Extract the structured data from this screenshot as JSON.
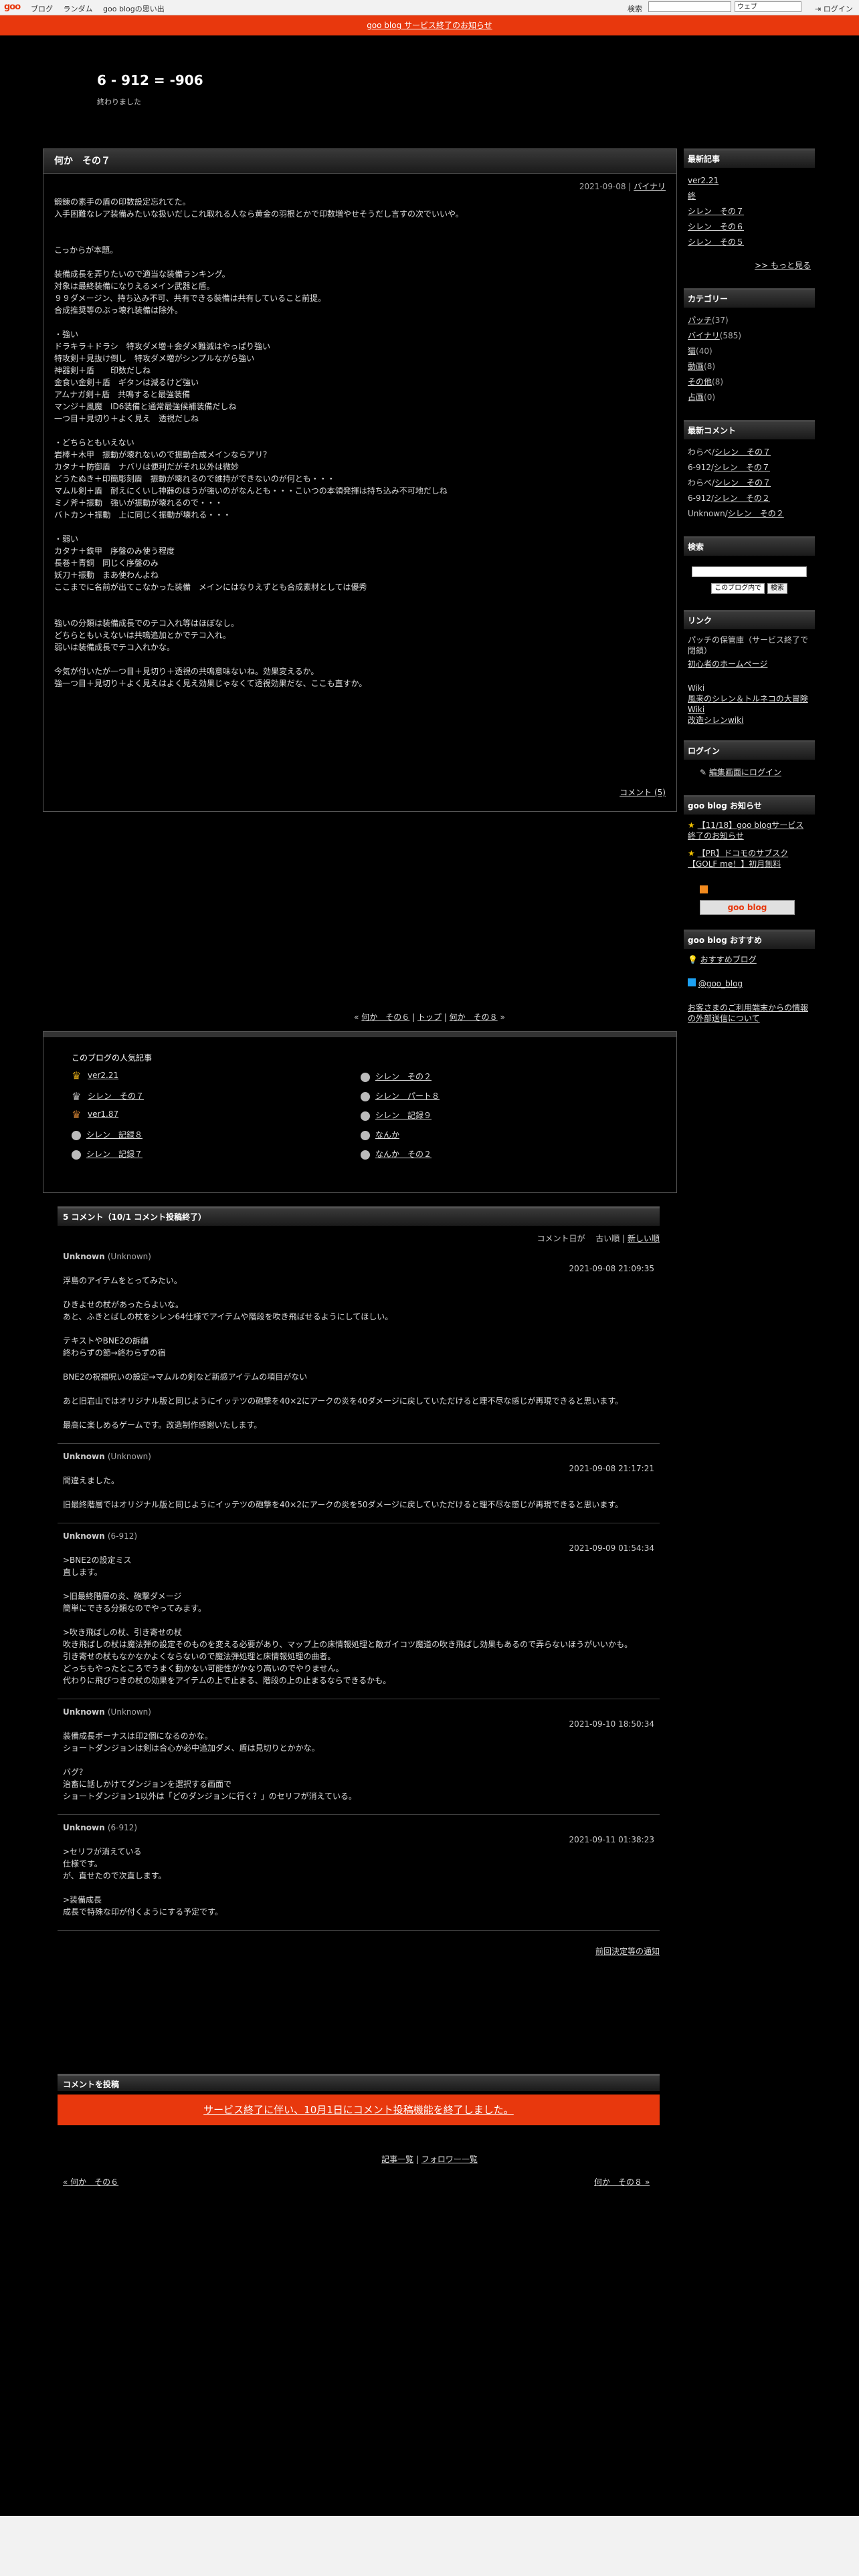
{
  "topbar": {
    "logo": "goo",
    "nav": [
      "ブログ",
      "ランダム",
      "goo blogの思い出"
    ],
    "search_label": "検索",
    "search_select": "ウェブ",
    "login": "ログイン"
  },
  "notice": "goo blog サービス終了のお知らせ",
  "blog": {
    "title": "6 - 912 = -906",
    "subtitle": "終わりました"
  },
  "article": {
    "title": "何か　その７",
    "date": "2021-09-08",
    "category": "バイナリ",
    "lines": [
      "鍛錬の素手の盾の印数設定忘れてた。",
      "入手困難なレア装備みたいな扱いだしこれ取れる人なら黄金の羽根とかで印数増やせそうだし言すの次でいいや。",
      "",
      "",
      "こっからが本題。",
      "",
      "装備成長を弄りたいので適当な装備ランキング。",
      "対象は最終装備になりえるメイン武器と盾。",
      "９９ダメージン、持ち込み不可、共有できる装備は共有していること前提。",
      "合成推奨等のぶっ壊れ装備は除外。",
      "",
      "・強い",
      "ドラキラ＋ドラシ　特攻ダメ増＋会ダメ難減はやっぱり強い",
      "特攻剣＋見抜け倒し　特攻ダメ増がシンプルながら強い",
      "神器剣＋盾　　印数だしね",
      "金食い金剣＋盾　ギタンは減るけど強い",
      "アムナガ剣＋盾　共鳴すると最強装備",
      "マンジ＋風魔　ID6装備と通常最強候補装備だしね",
      "一つ目＋見切り＋よく見え　透視だしね",
      "",
      "・どちらともいえない",
      "岩棒＋木甲　振動が壊れないので振動合成メインならアリ？",
      "カタナ＋防御盾　ナバリは便利だがそれ以外は微妙",
      "どうたぬき＋印簡彫刻盾　振動が壊れるので維持ができないのが何とも・・・",
      "マムル剣＋盾　耐えにくいし神器のほうが強いのがなんとも・・・こいつの本領発揮は持ち込み不可地だしね",
      "ミノ斧＋振動　強いが振動が壊れるので・・・",
      "バトカン＋振動　上に同じく振動が壊れる・・・",
      "",
      "・弱い",
      "カタナ＋鉄甲　序盤のみ使う程度",
      "長巻＋青銅　同じく序盤のみ",
      "妖刀＋振動　まあ使わんよね",
      "ここまでに名前が出てこなかった装備　メインにはなりえずとも合成素材としては優秀",
      "",
      "",
      "強いの分類は装備成長でのテコ入れ等はほぼなし。",
      "どちらともいえないは共鳴追加とかでテコ入れ。",
      "弱いは装備成長でテコ入れかな。",
      "",
      "今気が付いたが一つ目＋見切り＋透視の共鳴意味ないね。効果変えるか。",
      "強一つ目＋見切り＋よく見えはよく見え効果じゃなくて透視効果だな、ここも直すか。"
    ],
    "comment_link": "コメント (5)"
  },
  "pager": {
    "prev": "何か　その６",
    "top": "トップ",
    "next": "何か　その８"
  },
  "popular": {
    "title": "このブログの人気記事",
    "left": [
      "ver2.21",
      "シレン　その７",
      "ver1.87",
      "シレン　記録８",
      "シレン　記録７"
    ],
    "right": [
      "シレン　その２",
      "シレン　パート８",
      "シレン　記録９",
      "なんか",
      "なんか　その２"
    ]
  },
  "sidebar": {
    "recent": {
      "title": "最新記事",
      "items": [
        "ver2.21",
        "終",
        "シレン　その７",
        "シレン　その６",
        "シレン　その５"
      ],
      "more": ">> もっと見る"
    },
    "category": {
      "title": "カテゴリー",
      "items": [
        {
          "name": "パッチ",
          "count": "(37)"
        },
        {
          "name": "バイナリ",
          "count": "(585)"
        },
        {
          "name": "猫",
          "count": "(40)"
        },
        {
          "name": "動画",
          "count": "(8)"
        },
        {
          "name": "その他",
          "count": "(8)"
        },
        {
          "name": "占画",
          "count": "(0)"
        }
      ]
    },
    "latest_comments": {
      "title": "最新コメント",
      "items": [
        {
          "who": "わらべ/",
          "post": "シレン　その７"
        },
        {
          "who": "6-912/",
          "post": "シレン　その７"
        },
        {
          "who": "わらべ/",
          "post": "シレン　その７"
        },
        {
          "who": "6-912/",
          "post": "シレン　その２"
        },
        {
          "who": "Unknown/",
          "post": "シレン　その２"
        }
      ]
    },
    "search": {
      "title": "検索",
      "select": "このブログ内で",
      "button": "検索"
    },
    "links": {
      "title": "リンク",
      "items": [
        "パッチの保管庫（サービス終了で閉鎖）",
        "初心者のホームページ",
        "Wiki",
        "風来のシレン＆トルネコの大冒険 Wiki",
        "改造シレンwiki"
      ]
    },
    "login": {
      "title": "ログイン",
      "item": "編集画面にログイン"
    },
    "info": {
      "title": "goo blog お知らせ",
      "items": [
        "【11/18】goo blogサービス終了のお知らせ",
        "【PR】ドコモのサブスク【GOLF me！】初月無料"
      ],
      "badge": "goo blog"
    },
    "recommend": {
      "title": "goo blog おすすめ",
      "item": "おすすめブログ",
      "twitter": "@goo_blog",
      "external": "お客さまのご利用端末からの情報の外部送信について"
    }
  },
  "comments": {
    "header": "5 コメント（10/1 コメント投稿終了）",
    "sort_label": "コメント日が",
    "sort_old": "古い順",
    "sort_new": "新しい順",
    "items": [
      {
        "author": "Unknown",
        "paren": "(Unknown)",
        "date": "2021-09-08 21:09:35",
        "lines": [
          "浮島のアイテムをとってみたい。",
          "",
          "ひきよせの杖があったらよいな。",
          "あと、ふきとばしの杖をシレン64仕様でアイテムや階段を吹き飛ばせるようにしてほしい。",
          "",
          "テキストやBNE2の訴績",
          "終わらずの節→終わらずの宿",
          "",
          "BNE2の祝福呪いの設定→マムルの剣など新感アイテムの項目がない",
          "",
          "あと旧岩山ではオリジナル版と同じようにイッテツの砲撃を40×2にアークの炎を40ダメージに戻していただけると理不尽な感じが再現できると思います。",
          "",
          "最高に楽しめるゲームです。改造制作感謝いたします。"
        ]
      },
      {
        "author": "Unknown",
        "paren": "(Unknown)",
        "date": "2021-09-08 21:17:21",
        "lines": [
          "間違えました。",
          "",
          "旧最終階層ではオリジナル版と同じようにイッテツの砲撃を40×2にアークの炎を50ダメージに戻していただけると理不尽な感じが再現できると思います。"
        ]
      },
      {
        "author": "Unknown",
        "paren": "(6-912)",
        "date": "2021-09-09 01:54:34",
        "lines": [
          ">BNE2の設定ミス",
          "直します。",
          "",
          ">旧最終階層の炎、砲撃ダメージ",
          "簡単にできる分類なのでやってみます。",
          "",
          ">吹き飛ばしの杖、引き寄せの杖",
          "吹き飛ばしの杖は魔法弾の設定そのものを変える必要があり、マップ上の床情報処理と敵ガイコツ魔道の吹き飛ばし効果もあるので弄らないほうがいいかも。",
          "引き寄せの杖もなかなかよくならないので魔法弾処理と床情報処理の曲者。",
          "どっちもやったところでうまく動かない可能性がかなり高いのでやりません。",
          "代わりに飛びつきの杖の効果をアイテムの上で止まる、階段の上の止まるならできるかも。"
        ]
      },
      {
        "author": "Unknown",
        "paren": "(Unknown)",
        "date": "2021-09-10 18:50:34",
        "lines": [
          "装備成長ボーナスは印2個になるのかな。",
          "ショートダンジョンは剣は合心か必中追加ダメ、盾は見切りとかかな。",
          "",
          "バグ？",
          "治畜に話しかけてダンジョンを選択する画面で",
          "ショートダンジョン1以外は「どのダンジョンに行く？」のセリフが消えている。"
        ]
      },
      {
        "author": "Unknown",
        "paren": "(6-912)",
        "date": "2021-09-11 01:38:23",
        "lines": [
          ">セリフが消えている",
          "仕様です。",
          "が、直せたので次直します。",
          "",
          ">装備成長",
          "成長で特殊な印が付くようにする予定です。"
        ]
      }
    ],
    "trackback": "前回決定等の通知"
  },
  "post": {
    "header": "コメントを投稿",
    "closed": "サービス終了に伴い、10月1日にコメント投稿機能を終了しました。"
  },
  "bottom": {
    "links_a": "記事一覧",
    "links_b": "フォロワー一覧",
    "prev": "« 何か　その６",
    "next": "何か　その８ »"
  },
  "colors": {
    "accent": "#e8380d",
    "background": "#000000"
  }
}
